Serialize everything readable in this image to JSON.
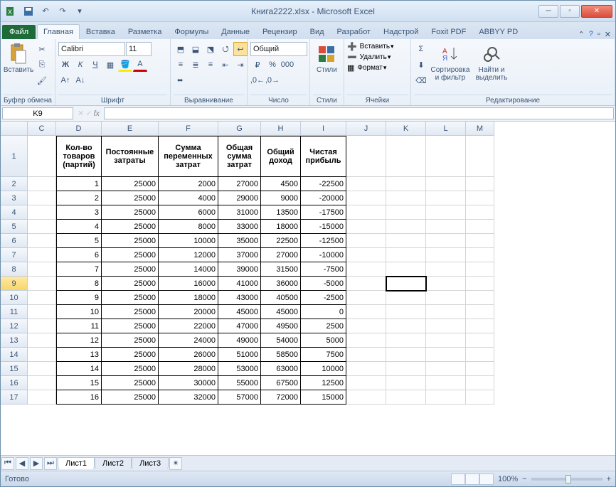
{
  "title": "Книга2222.xlsx - Microsoft Excel",
  "tabs": {
    "file": "Файл",
    "home": "Главная",
    "insert": "Вставка",
    "layout": "Разметка",
    "formulas": "Формулы",
    "data": "Данные",
    "review": "Рецензир",
    "view": "Вид",
    "dev": "Разработ",
    "addins": "Надстрой",
    "foxit": "Foxit PDF",
    "abbyy": "ABBYY PD"
  },
  "groups": {
    "clipboard": "Буфер обмена",
    "font": "Шрифт",
    "align": "Выравнивание",
    "number": "Число",
    "styles": "Стили",
    "cells": "Ячейки",
    "editing": "Редактирование",
    "paste": "Вставить",
    "fontname": "Calibri",
    "fontsize": "11",
    "numfmt": "Общий",
    "insertcell": "Вставить",
    "deletecell": "Удалить",
    "formatcell": "Формат",
    "styleslbl": "Стили",
    "sort": "Сортировка\nи фильтр",
    "find": "Найти и\nвыделить"
  },
  "namebox": "K9",
  "formula": "",
  "colheaders": [
    "",
    "C",
    "D",
    "E",
    "F",
    "G",
    "H",
    "I",
    "J",
    "K",
    "L",
    "M"
  ],
  "rowheaders": [
    "1",
    "2",
    "3",
    "4",
    "5",
    "6",
    "7",
    "8",
    "9",
    "10",
    "11",
    "12",
    "13",
    "14",
    "15",
    "16",
    "17"
  ],
  "tablehead": [
    "Кол-во товаров (партий)",
    "Постоянные затраты",
    "Сумма переменных затрат",
    "Общая сумма затрат",
    "Общий доход",
    "Чистая прибыль"
  ],
  "rows": [
    [
      1,
      25000,
      2000,
      27000,
      4500,
      -22500
    ],
    [
      2,
      25000,
      4000,
      29000,
      9000,
      -20000
    ],
    [
      3,
      25000,
      6000,
      31000,
      13500,
      -17500
    ],
    [
      4,
      25000,
      8000,
      33000,
      18000,
      -15000
    ],
    [
      5,
      25000,
      10000,
      35000,
      22500,
      -12500
    ],
    [
      6,
      25000,
      12000,
      37000,
      27000,
      -10000
    ],
    [
      7,
      25000,
      14000,
      39000,
      31500,
      -7500
    ],
    [
      8,
      25000,
      16000,
      41000,
      36000,
      -5000
    ],
    [
      9,
      25000,
      18000,
      43000,
      40500,
      -2500
    ],
    [
      10,
      25000,
      20000,
      45000,
      45000,
      0
    ],
    [
      11,
      25000,
      22000,
      47000,
      49500,
      2500
    ],
    [
      12,
      25000,
      24000,
      49000,
      54000,
      5000
    ],
    [
      13,
      25000,
      26000,
      51000,
      58500,
      7500
    ],
    [
      14,
      25000,
      28000,
      53000,
      63000,
      10000
    ],
    [
      15,
      25000,
      30000,
      55000,
      67500,
      12500
    ],
    [
      16,
      25000,
      32000,
      57000,
      72000,
      15000
    ]
  ],
  "sheets": [
    "Лист1",
    "Лист2",
    "Лист3"
  ],
  "status": "Готово",
  "zoom": "100%"
}
